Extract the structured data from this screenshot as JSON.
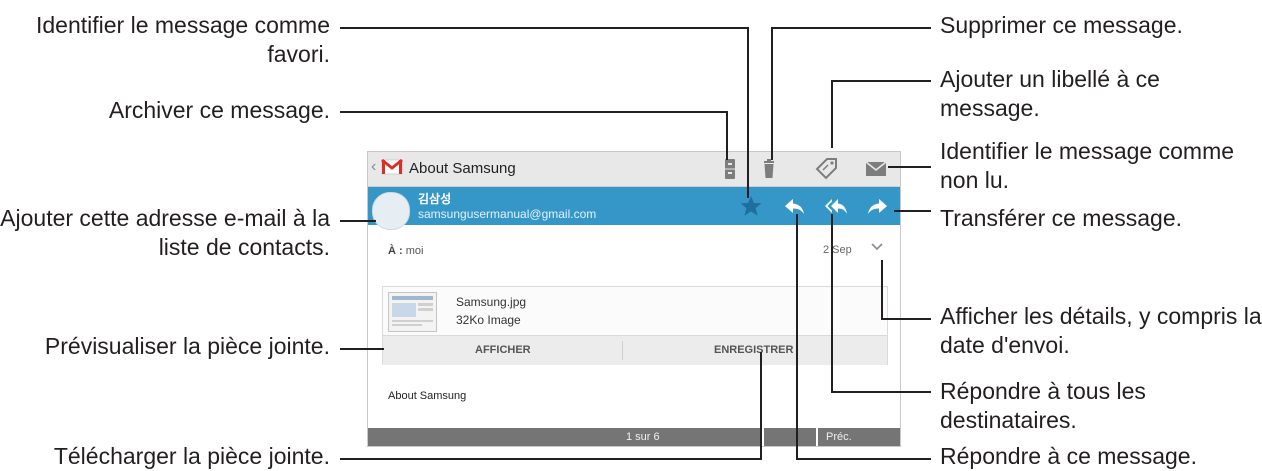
{
  "callouts_left": [
    {
      "id": "star",
      "text": "Identifier le message comme favori."
    },
    {
      "id": "archive",
      "text": "Archiver ce message."
    },
    {
      "id": "add_contact",
      "text": "Ajouter cette adresse e-mail à la liste de contacts."
    },
    {
      "id": "preview",
      "text": "Prévisualiser la pièce jointe."
    },
    {
      "id": "download",
      "text": "Télécharger la pièce jointe."
    }
  ],
  "callouts_right": [
    {
      "id": "delete",
      "text": "Supprimer ce message."
    },
    {
      "id": "label",
      "text": "Ajouter un libellé à ce message."
    },
    {
      "id": "unread",
      "text": "Identifier le message comme non lu."
    },
    {
      "id": "forward",
      "text": "Transférer ce message."
    },
    {
      "id": "details",
      "text": "Afficher les détails, y compris la date d'envoi."
    },
    {
      "id": "reply_all",
      "text": "Répondre à tous les destinataires."
    },
    {
      "id": "reply",
      "text": "Répondre à ce message."
    }
  ],
  "screen": {
    "header": {
      "back_glyph": "‹",
      "title": "About Samsung"
    },
    "sender": {
      "name": "김삼성",
      "email": "samsungusermanual@gmail.com"
    },
    "recipient": {
      "label": "À :",
      "value": "moi",
      "date": "2 Sep"
    },
    "attachment": {
      "filename": "Samsung.jpg",
      "meta": "32Ko Image",
      "view_label": "AFFICHER",
      "save_label": "ENREGISTRER"
    },
    "body_text": "About Samsung",
    "footer": {
      "pager": "1 sur 6",
      "prev_label": "Préc."
    }
  },
  "icons": {
    "header": [
      "gmail-logo-icon",
      "archive-icon",
      "trash-icon",
      "label-tag-icon",
      "mark-unread-envelope-icon"
    ],
    "sender_bar": [
      "star-icon",
      "reply-icon",
      "reply-all-icon",
      "forward-icon"
    ],
    "details": "chevron-down-icon"
  },
  "colors": {
    "sender_bar": "#3596c8",
    "leader_line": "#231f20",
    "star_outline": "#1f6f9e",
    "gmail_red": "#d93025"
  }
}
